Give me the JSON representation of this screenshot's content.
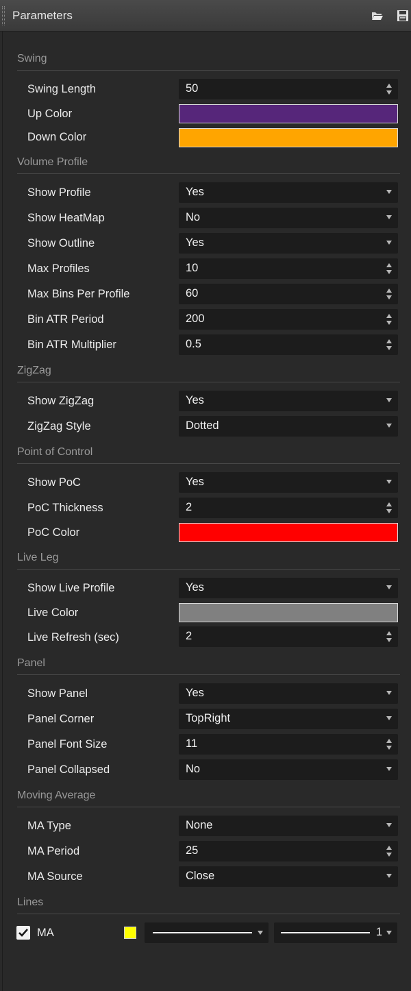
{
  "window": {
    "title": "Parameters",
    "icons": [
      "folder-open-icon",
      "save-icon"
    ]
  },
  "sections": {
    "swing": {
      "title": "Swing",
      "swing_length": {
        "label": "Swing Length",
        "value": "50"
      },
      "up_color": {
        "label": "Up Color",
        "color": "#56267a"
      },
      "down_color": {
        "label": "Down Color",
        "color": "#ffa500"
      }
    },
    "volume_profile": {
      "title": "Volume Profile",
      "show_profile": {
        "label": "Show Profile",
        "value": "Yes"
      },
      "show_heatmap": {
        "label": "Show HeatMap",
        "value": "No"
      },
      "show_outline": {
        "label": "Show Outline",
        "value": "Yes"
      },
      "max_profiles": {
        "label": "Max Profiles",
        "value": "10"
      },
      "max_bins": {
        "label": "Max Bins Per Profile",
        "value": "60"
      },
      "bin_atr_period": {
        "label": "Bin ATR Period",
        "value": "200"
      },
      "bin_atr_multiplier": {
        "label": "Bin ATR Multiplier",
        "value": "0.5"
      }
    },
    "zigzag": {
      "title": "ZigZag",
      "show_zigzag": {
        "label": "Show ZigZag",
        "value": "Yes"
      },
      "zigzag_style": {
        "label": "ZigZag Style",
        "value": "Dotted"
      }
    },
    "poc": {
      "title": "Point of Control",
      "show_poc": {
        "label": "Show PoC",
        "value": "Yes"
      },
      "poc_thickness": {
        "label": "PoC Thickness",
        "value": "2"
      },
      "poc_color": {
        "label": "PoC Color",
        "color": "#ff0000"
      }
    },
    "live_leg": {
      "title": "Live Leg",
      "show_live_profile": {
        "label": "Show Live Profile",
        "value": "Yes"
      },
      "live_color": {
        "label": "Live Color",
        "color": "#808080"
      },
      "live_refresh": {
        "label": "Live Refresh (sec)",
        "value": "2"
      }
    },
    "panel": {
      "title": "Panel",
      "show_panel": {
        "label": "Show Panel",
        "value": "Yes"
      },
      "panel_corner": {
        "label": "Panel Corner",
        "value": "TopRight"
      },
      "panel_font_size": {
        "label": "Panel Font Size",
        "value": "11"
      },
      "panel_collapsed": {
        "label": "Panel Collapsed",
        "value": "No"
      }
    },
    "moving_average": {
      "title": "Moving Average",
      "ma_type": {
        "label": "MA Type",
        "value": "None"
      },
      "ma_period": {
        "label": "MA Period",
        "value": "25"
      },
      "ma_source": {
        "label": "MA Source",
        "value": "Close"
      }
    },
    "lines": {
      "title": "Lines",
      "ma": {
        "label": "MA",
        "checked": true,
        "color": "#ffff00",
        "style": "solid",
        "width": "1"
      }
    }
  }
}
